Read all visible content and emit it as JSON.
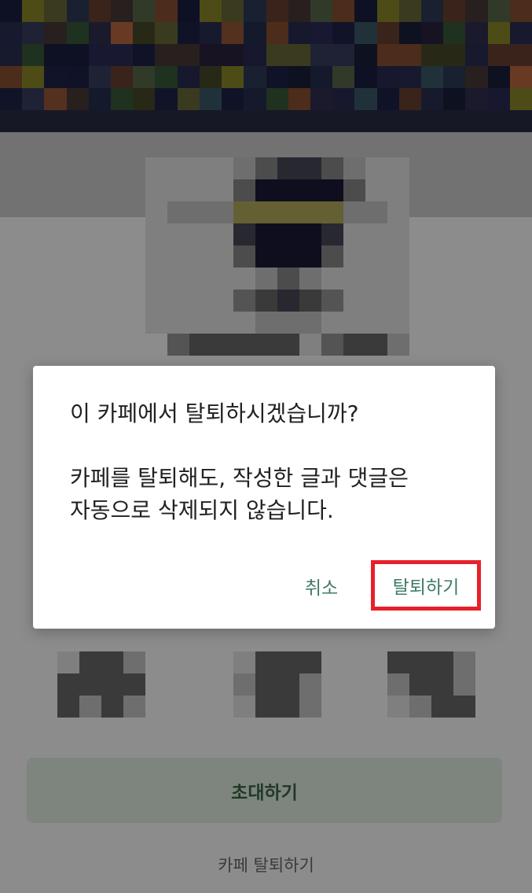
{
  "dialog": {
    "title": "이 카페에서 탈퇴하시겠습니까?",
    "message_line1": "카페를 탈퇴해도, 작성한 글과 댓글은",
    "message_line2": "자동으로 삭제되지 않습니다.",
    "cancel_label": "취소",
    "confirm_label": "탈퇴하기"
  },
  "page": {
    "invite_label": "초대하기",
    "leave_label": "카페 탈퇴하기"
  },
  "colors": {
    "dialog_button_text": "#3f7a68",
    "highlight_border": "#e8202a",
    "invite_button_bg": "#e4f2e6"
  }
}
